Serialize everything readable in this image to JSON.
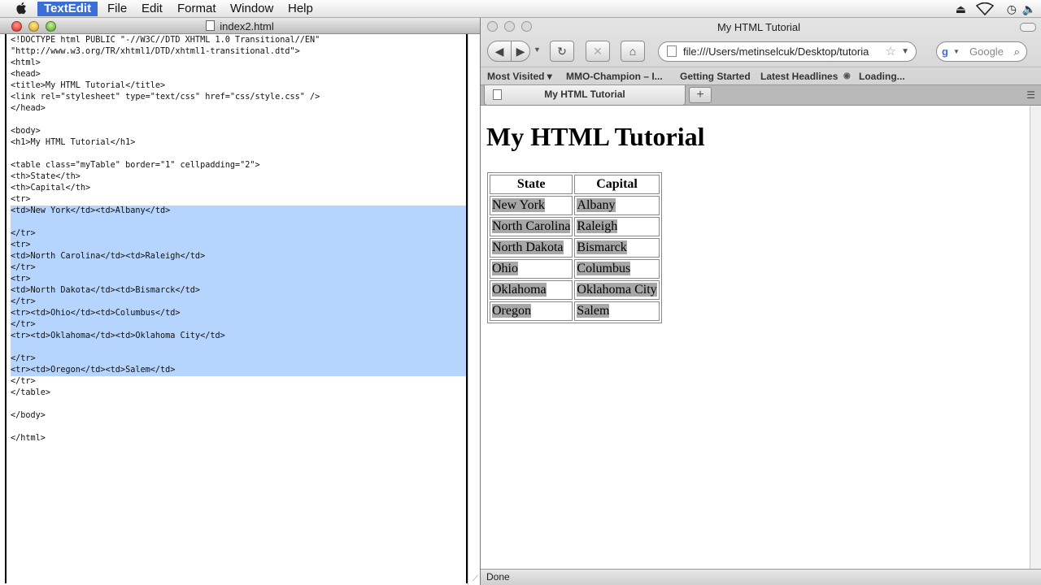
{
  "menubar": {
    "app": "TextEdit",
    "items": [
      "File",
      "Edit",
      "Format",
      "Window",
      "Help"
    ]
  },
  "textedit": {
    "window_title": "index2.html",
    "lines": [
      "<!DOCTYPE html PUBLIC \"-//W3C//DTD XHTML 1.0 Transitional//EN\"",
      "\"http://www.w3.org/TR/xhtml1/DTD/xhtml1-transitional.dtd\">",
      "<html>",
      "<head>",
      "<title>My HTML Tutorial</title>",
      "<link rel=\"stylesheet\" type=\"text/css\" href=\"css/style.css\" />",
      "</head>",
      "",
      "<body>",
      "<h1>My HTML Tutorial</h1>",
      "",
      "<table class=\"myTable\" border=\"1\" cellpadding=\"2\">",
      "<th>State</th>",
      "<th>Capital</th>",
      "<tr>",
      "<td>New York</td><td>Albany</td>",
      "",
      "</tr>",
      "<tr>",
      "<td>North Carolina</td><td>Raleigh</td>",
      "</tr>",
      "<tr>",
      "<td>North Dakota</td><td>Bismarck</td>",
      "</tr>",
      "<tr><td>Ohio</td><td>Columbus</td>",
      "</tr>",
      "<tr><td>Oklahoma</td><td>Oklahoma City</td>",
      "",
      "</tr>",
      "<tr><td>Oregon</td><td>Salem</td>",
      "</tr>",
      "</table>",
      "",
      "</body>",
      "",
      "</html>"
    ],
    "selected_line_range": [
      15,
      29
    ]
  },
  "firefox": {
    "window_title": "My HTML Tutorial",
    "url": "file:///Users/metinselcuk/Desktop/tutoria",
    "search_placeholder": "Google",
    "bookmarks": [
      "Most Visited ▾",
      "MMO-Champion – I...",
      "Getting Started",
      "Latest Headlines",
      "Loading..."
    ],
    "tab_title": "My HTML Tutorial",
    "status": "Done",
    "page": {
      "heading": "My HTML Tutorial",
      "table_headers": [
        "State",
        "Capital"
      ],
      "rows": [
        [
          "New York",
          "Albany"
        ],
        [
          "North Carolina",
          "Raleigh"
        ],
        [
          "North Dakota",
          "Bismarck"
        ],
        [
          "Ohio",
          "Columbus"
        ],
        [
          "Oklahoma",
          "Oklahoma City"
        ],
        [
          "Oregon",
          "Salem"
        ]
      ]
    }
  }
}
